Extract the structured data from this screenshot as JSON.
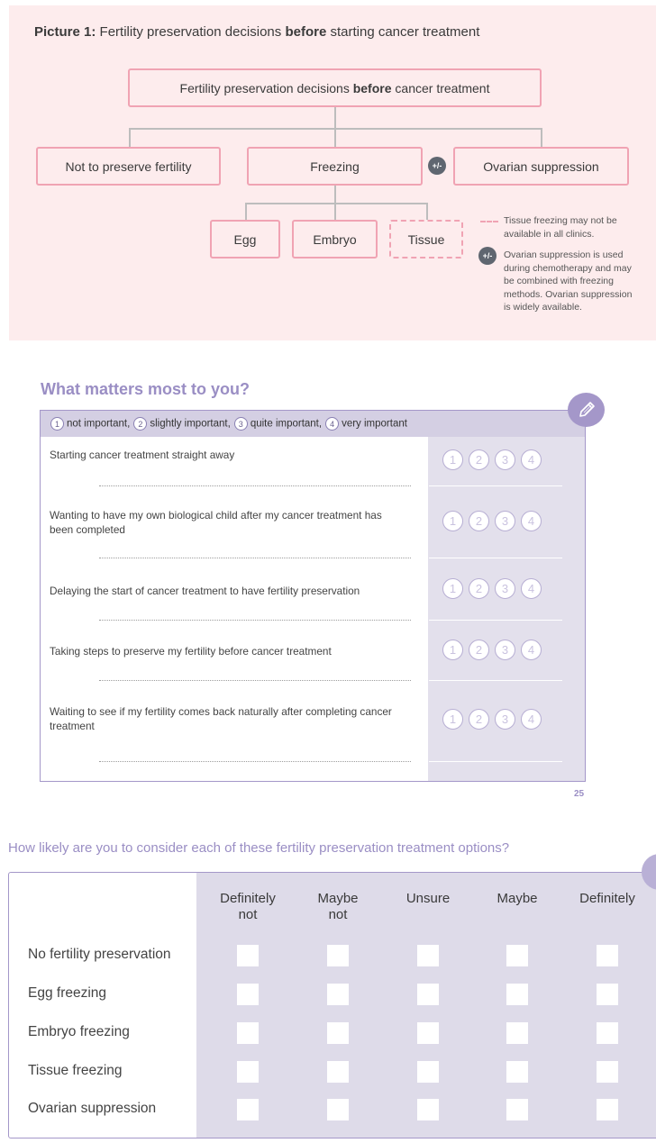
{
  "picture": {
    "title_prefix": "Picture 1:",
    "title_main": "Fertility preservation decisions",
    "title_bold": "before",
    "title_suffix": "starting cancer treatment",
    "root_pre": "Fertility preservation decisions",
    "root_bold": "before",
    "root_post": "cancer treatment",
    "nodes": {
      "not_preserve": "Not to preserve fertility",
      "freezing": "Freezing",
      "ovarian": "Ovarian suppression",
      "egg": "Egg",
      "embryo": "Embryo",
      "tissue": "Tissue"
    },
    "plus_minus": "+/-",
    "legend_tissue": "Tissue freezing may not be available in all clinics.",
    "legend_ovarian": "Ovarian suppression is used during chemotherapy and may be combined with freezing methods. Ovarian suppression is widely available.",
    "colors": {
      "panel_bg": "#fdeced",
      "box_border": "#f0a3b3",
      "icon_bg": "#5f6670"
    }
  },
  "what_matters": {
    "heading": "What matters most to you?",
    "key": [
      {
        "num": "1",
        "label": "not important,"
      },
      {
        "num": "2",
        "label": "slightly important,"
      },
      {
        "num": "3",
        "label": "quite important,"
      },
      {
        "num": "4",
        "label": "very important"
      }
    ],
    "rows": [
      {
        "text": "Starting cancer treatment straight away"
      },
      {
        "text": "Wanting to have my own biological child after my cancer treatment has been completed"
      },
      {
        "text": "Delaying the start of cancer treatment to have fertility preservation"
      },
      {
        "text": "Taking steps to preserve my fertility before cancer treatment"
      },
      {
        "text": "Waiting to see if my fertility comes back naturally after completing cancer treatment"
      }
    ],
    "rating_options": [
      "1",
      "2",
      "3",
      "4"
    ],
    "edit_icon": "pencil-icon",
    "page_number": "25",
    "colors": {
      "accent": "#a497c9",
      "heading": "#9a8ec4",
      "header_bg": "#d4cfe3",
      "rating_col_bg": "#e3e0ec"
    }
  },
  "likely": {
    "heading": "How likely are you to consider each of these fertility preservation treatment options?",
    "columns": [
      [
        "Definitely",
        "not"
      ],
      [
        "Maybe",
        "not"
      ],
      [
        "Unsure",
        ""
      ],
      [
        "Maybe",
        ""
      ],
      [
        "Definitely",
        ""
      ]
    ],
    "rows": [
      "No fertility preservation",
      "Egg freezing",
      "Embryo freezing",
      "Tissue freezing",
      "Ovarian suppression"
    ],
    "colors": {
      "shade": "#dedbe9",
      "border": "#a497c9"
    }
  }
}
